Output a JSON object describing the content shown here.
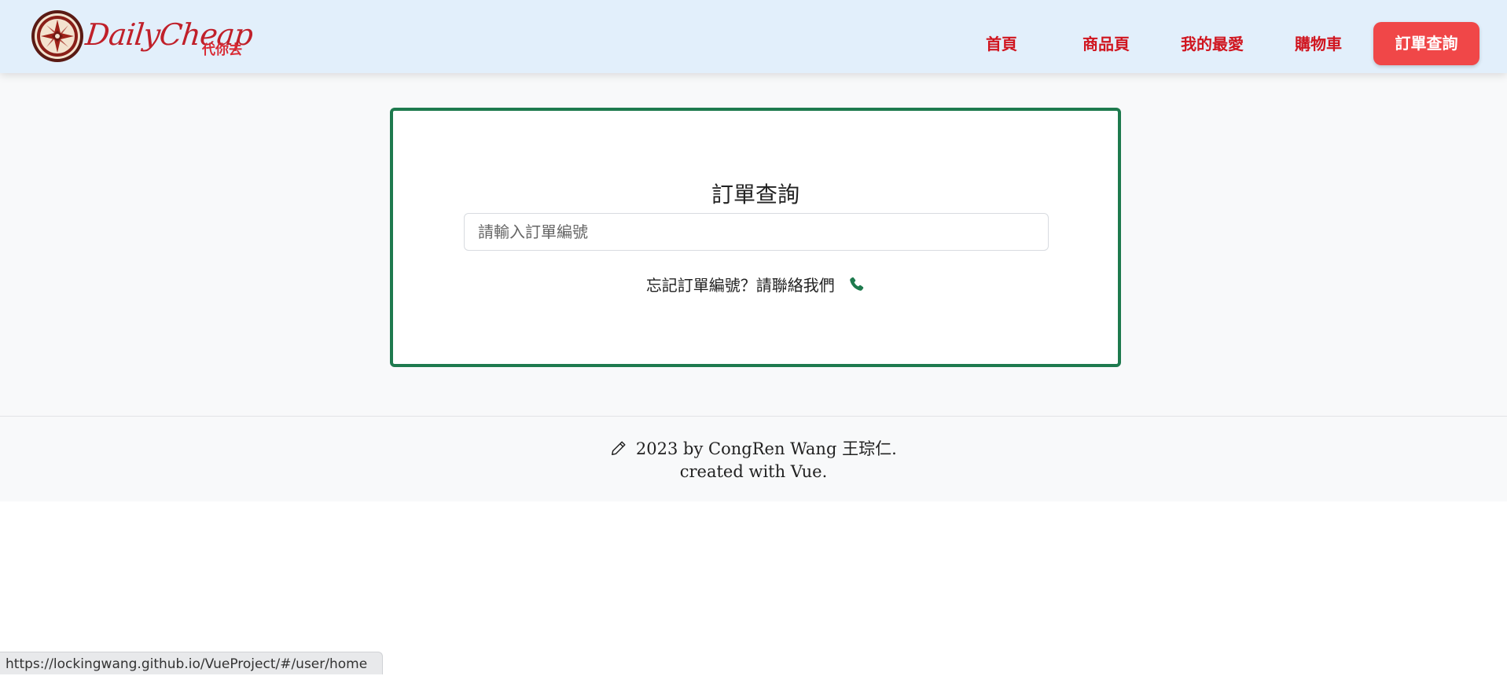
{
  "colors": {
    "nav_background": "#e2effb",
    "nav_text": "#d0151f",
    "active_button": "#f04748",
    "card_border": "#1e7a4e",
    "phone_icon": "#1e7a4e"
  },
  "brand": {
    "logo_text": "DailyCheap",
    "logo_sub": "代你去",
    "emblem_icon": "brand-emblem-icon"
  },
  "nav": {
    "items": [
      {
        "label": "首頁"
      },
      {
        "label": "商品頁"
      },
      {
        "label": "我的最愛"
      },
      {
        "label": "購物車"
      }
    ],
    "active_label": "訂單查詢"
  },
  "order_search": {
    "title": "訂單查詢",
    "input_placeholder": "請輸入訂單編號",
    "input_value": "",
    "help_text": "忘記訂單編號？請聯絡我們",
    "contact_icon": "phone-icon"
  },
  "footer": {
    "credit_icon": "pencil-icon",
    "credit": "2023 by CongRen Wang 王琮仁.",
    "made_with": "created with Vue."
  },
  "status_bar": {
    "url": "https://lockingwang.github.io/VueProject/#/user/home"
  }
}
